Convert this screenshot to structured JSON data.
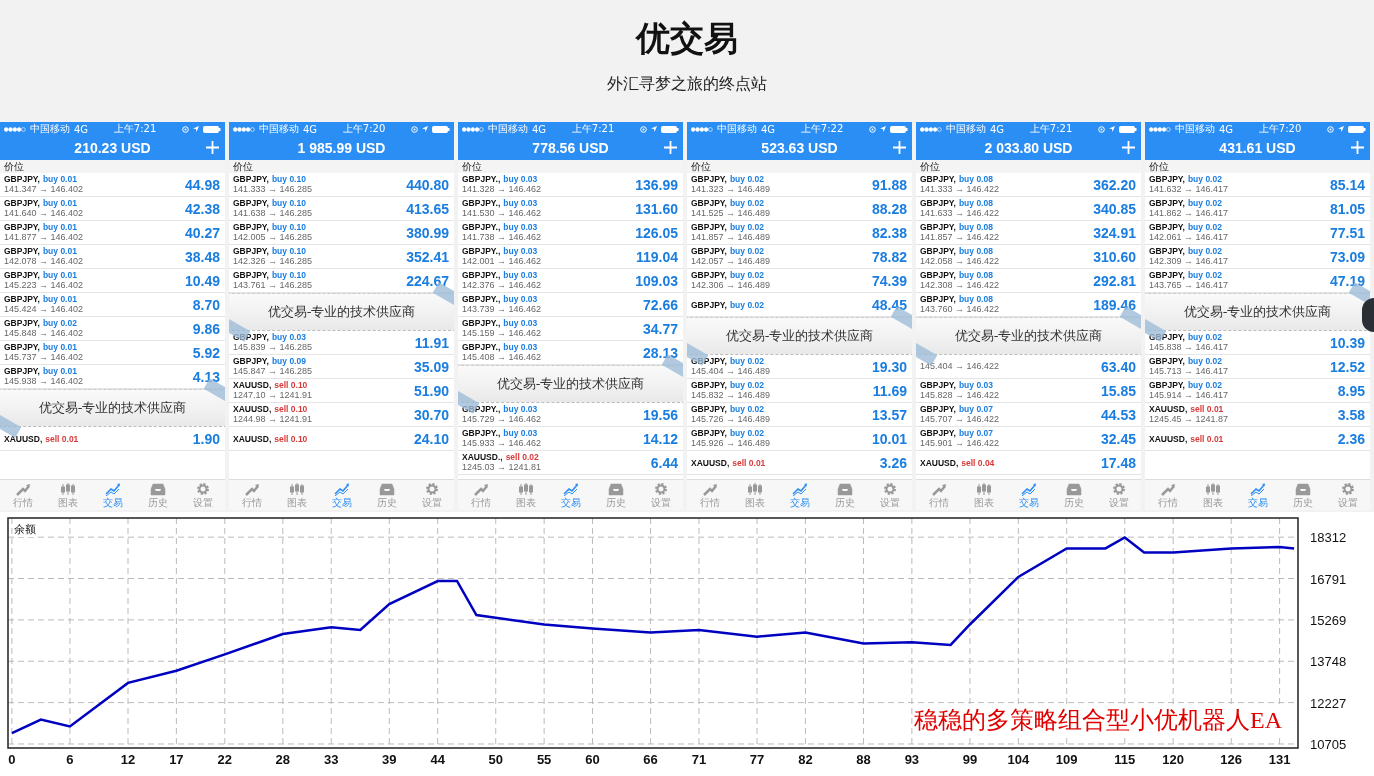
{
  "header": {
    "title": "优交易",
    "subtitle": "外汇寻梦之旅的终点站"
  },
  "phones": [
    {
      "carrier": "中国移动",
      "network": "4G",
      "time": "上午7:21",
      "balance": "210.23 USD",
      "plus": true,
      "column_label": "价位",
      "rows": [
        {
          "kind": "buy",
          "symbol": "GBPJPY,",
          "side": "buy 0.01",
          "price": "141.347 → 146.402",
          "profit": "44.98"
        },
        {
          "kind": "buy",
          "symbol": "GBPJPY,",
          "side": "buy 0.01",
          "price": "141.640 → 146.402",
          "profit": "42.38"
        },
        {
          "kind": "buy",
          "symbol": "GBPJPY,",
          "side": "buy 0.01",
          "price": "141.877 → 146.402",
          "profit": "40.27"
        },
        {
          "kind": "buy",
          "symbol": "GBPJPY,",
          "side": "buy 0.01",
          "price": "142.078 → 146.402",
          "profit": "38.48"
        },
        {
          "kind": "buy",
          "symbol": "GBPJPY,",
          "side": "buy 0.01",
          "price": "145.223 → 146.402",
          "profit": "10.49"
        },
        {
          "kind": "buy",
          "symbol": "GBPJPY,",
          "side": "buy 0.01",
          "price": "145.424 → 146.402",
          "profit": "8.70"
        },
        {
          "kind": "buy",
          "symbol": "GBPJPY,",
          "side": "buy 0.02",
          "price": "145.848 → 146.402",
          "profit": "9.86"
        },
        {
          "kind": "buy",
          "symbol": "GBPJPY,",
          "side": "buy 0.01",
          "price": "145.737 → 146.402",
          "profit": "5.92"
        },
        {
          "kind": "buy",
          "symbol": "GBPJPY,",
          "side": "buy 0.01",
          "price": "145.938 → 146.402",
          "profit": "4.13"
        },
        {
          "kind": "banner",
          "text": "优交易-专业的技术供应商"
        },
        {
          "kind": "sell",
          "symbol": "XAUUSD,",
          "side": "sell 0.01",
          "profit": "1.90"
        }
      ],
      "tabs": [
        {
          "kind": "quotes",
          "label": "行情",
          "selected": false
        },
        {
          "kind": "chart",
          "label": "图表",
          "selected": false
        },
        {
          "kind": "trade",
          "label": "交易",
          "selected": true
        },
        {
          "kind": "history",
          "label": "历史",
          "selected": false
        },
        {
          "kind": "settings",
          "label": "设置",
          "selected": false
        }
      ]
    },
    {
      "carrier": "中国移动",
      "network": "4G",
      "time": "上午7:20",
      "balance": "1 985.99 USD",
      "plus": false,
      "column_label": "价位",
      "rows": [
        {
          "kind": "buy",
          "symbol": "GBPJPY,",
          "side": "buy 0.10",
          "price": "141.333 → 146.285",
          "profit": "440.80"
        },
        {
          "kind": "buy",
          "symbol": "GBPJPY,",
          "side": "buy 0.10",
          "price": "141.638 → 146.285",
          "profit": "413.65"
        },
        {
          "kind": "buy",
          "symbol": "GBPJPY,",
          "side": "buy 0.10",
          "price": "142.005 → 146.285",
          "profit": "380.99"
        },
        {
          "kind": "buy",
          "symbol": "GBPJPY,",
          "side": "buy 0.10",
          "price": "142.326 → 146.285",
          "profit": "352.41"
        },
        {
          "kind": "buy",
          "symbol": "GBPJPY,",
          "side": "buy 0.10",
          "price": "143.761 → 146.285",
          "profit": "224.67"
        },
        {
          "kind": "banner",
          "text": "优交易-专业的技术供应商"
        },
        {
          "kind": "buy",
          "symbol": "GBPJPY,",
          "side": "buy 0.03",
          "price": "145.839 → 146.285",
          "profit": "11.91"
        },
        {
          "kind": "buy",
          "symbol": "GBPJPY,",
          "side": "buy 0.09",
          "price": "145.847 → 146.285",
          "profit": "35.09"
        },
        {
          "kind": "sell",
          "symbol": "XAUUSD,",
          "side": "sell 0.10",
          "price": "1247.10 → 1241.91",
          "profit": "51.90"
        },
        {
          "kind": "sell",
          "symbol": "XAUUSD,",
          "side": "sell 0.10",
          "price": "1244.98 → 1241.91",
          "profit": "30.70"
        },
        {
          "kind": "sell",
          "symbol": "XAUUSD,",
          "side": "sell 0.10",
          "profit": "24.10"
        }
      ],
      "tabs": [
        {
          "kind": "quotes",
          "label": "行情",
          "selected": false
        },
        {
          "kind": "chart",
          "label": "图表",
          "selected": false
        },
        {
          "kind": "trade",
          "label": "交易",
          "selected": true
        },
        {
          "kind": "history",
          "label": "历史",
          "selected": false
        },
        {
          "kind": "settings",
          "label": "设置",
          "selected": false
        }
      ]
    },
    {
      "carrier": "中国移动",
      "network": "4G",
      "time": "上午7:21",
      "balance": "778.56 USD",
      "plus": true,
      "column_label": "价位",
      "rows": [
        {
          "kind": "buy",
          "symbol": "GBPJPY.,",
          "side": "buy 0.03",
          "price": "141.328 → 146.462",
          "profit": "136.99"
        },
        {
          "kind": "buy",
          "symbol": "GBPJPY.,",
          "side": "buy 0.03",
          "price": "141.530 → 146.462",
          "profit": "131.60"
        },
        {
          "kind": "buy",
          "symbol": "GBPJPY.,",
          "side": "buy 0.03",
          "price": "141.738 → 146.462",
          "profit": "126.05"
        },
        {
          "kind": "buy",
          "symbol": "GBPJPY.,",
          "side": "buy 0.03",
          "price": "142.001 → 146.462",
          "profit": "119.04"
        },
        {
          "kind": "buy",
          "symbol": "GBPJPY.,",
          "side": "buy 0.03",
          "price": "142.376 → 146.462",
          "profit": "109.03"
        },
        {
          "kind": "buy",
          "symbol": "GBPJPY.,",
          "side": "buy 0.03",
          "price": "143.739 → 146.462",
          "profit": "72.66"
        },
        {
          "kind": "buy",
          "symbol": "GBPJPY.,",
          "side": "buy 0.03",
          "price": "145.159 → 146.462",
          "profit": "34.77"
        },
        {
          "kind": "buy",
          "symbol": "GBPJPY.,",
          "side": "buy 0.03",
          "price": "145.408 → 146.462",
          "profit": "28.13"
        },
        {
          "kind": "banner",
          "text": "优交易-专业的技术供应商"
        },
        {
          "kind": "buy",
          "symbol": "GBPJPY.,",
          "side": "buy 0.03",
          "price": "145.729 → 146.462",
          "profit": "19.56"
        },
        {
          "kind": "buy",
          "symbol": "GBPJPY.,",
          "side": "buy 0.03",
          "price": "145.933 → 146.462",
          "profit": "14.12"
        },
        {
          "kind": "sell",
          "symbol": "XAUUSD.,",
          "side": "sell 0.02",
          "price": "1245.03 → 1241.81",
          "profit": "6.44"
        }
      ],
      "tabs": [
        {
          "kind": "quotes",
          "label": "行情",
          "selected": false
        },
        {
          "kind": "chart",
          "label": "图表",
          "selected": false
        },
        {
          "kind": "trade",
          "label": "交易",
          "selected": true
        },
        {
          "kind": "history",
          "label": "历史",
          "selected": false
        },
        {
          "kind": "settings",
          "label": "设置",
          "selected": false
        }
      ]
    },
    {
      "carrier": "中国移动",
      "network": "4G",
      "time": "上午7:22",
      "balance": "523.63 USD",
      "plus": true,
      "column_label": "价位",
      "rows": [
        {
          "kind": "buy",
          "symbol": "GBPJPY,",
          "side": "buy 0.02",
          "price": "141.323 → 146.489",
          "profit": "91.88"
        },
        {
          "kind": "buy",
          "symbol": "GBPJPY,",
          "side": "buy 0.02",
          "price": "141.525 → 146.489",
          "profit": "88.28"
        },
        {
          "kind": "buy",
          "symbol": "GBPJPY,",
          "side": "buy 0.02",
          "price": "141.857 → 146.489",
          "profit": "82.38"
        },
        {
          "kind": "buy",
          "symbol": "GBPJPY,",
          "side": "buy 0.02",
          "price": "142.057 → 146.489",
          "profit": "78.82"
        },
        {
          "kind": "buy",
          "symbol": "GBPJPY,",
          "side": "buy 0.02",
          "price": "142.306 → 146.489",
          "profit": "74.39"
        },
        {
          "kind": "buy",
          "symbol": "GBPJPY,",
          "side": "buy 0.02",
          "profit": "48.45"
        },
        {
          "kind": "banner",
          "text": "优交易-专业的技术供应商"
        },
        {
          "kind": "buy",
          "symbol": "GBPJPY,",
          "side": "buy 0.02",
          "price": "145.404 → 146.489",
          "profit": "19.30"
        },
        {
          "kind": "buy",
          "symbol": "GBPJPY,",
          "side": "buy 0.02",
          "price": "145.832 → 146.489",
          "profit": "11.69"
        },
        {
          "kind": "buy",
          "symbol": "GBPJPY,",
          "side": "buy 0.02",
          "price": "145.726 → 146.489",
          "profit": "13.57"
        },
        {
          "kind": "buy",
          "symbol": "GBPJPY,",
          "side": "buy 0.02",
          "price": "145.926 → 146.489",
          "profit": "10.01"
        },
        {
          "kind": "sell",
          "symbol": "XAUUSD,",
          "side": "sell 0.01",
          "profit": "3.26"
        }
      ],
      "tabs": [
        {
          "kind": "quotes",
          "label": "行情",
          "selected": false
        },
        {
          "kind": "chart",
          "label": "图表",
          "selected": false
        },
        {
          "kind": "trade",
          "label": "交易",
          "selected": true
        },
        {
          "kind": "history",
          "label": "历史",
          "selected": false
        },
        {
          "kind": "settings",
          "label": "设置",
          "selected": false
        }
      ]
    },
    {
      "carrier": "中国移动",
      "network": "4G",
      "time": "上午7:21",
      "balance": "2 033.80 USD",
      "plus": true,
      "column_label": "价位",
      "rows": [
        {
          "kind": "buy",
          "symbol": "GBPJPY,",
          "side": "buy 0.08",
          "price": "141.333 → 146.422",
          "profit": "362.20"
        },
        {
          "kind": "buy",
          "symbol": "GBPJPY,",
          "side": "buy 0.08",
          "price": "141.633 → 146.422",
          "profit": "340.85"
        },
        {
          "kind": "buy",
          "symbol": "GBPJPY,",
          "side": "buy 0.08",
          "price": "141.857 → 146.422",
          "profit": "324.91"
        },
        {
          "kind": "buy",
          "symbol": "GBPJPY,",
          "side": "buy 0.08",
          "price": "142.058 → 146.422",
          "profit": "310.60"
        },
        {
          "kind": "buy",
          "symbol": "GBPJPY,",
          "side": "buy 0.08",
          "price": "142.308 → 146.422",
          "profit": "292.81"
        },
        {
          "kind": "buy",
          "symbol": "GBPJPY,",
          "side": "buy 0.08",
          "price": "143.760 → 146.422",
          "profit": "189.46"
        },
        {
          "kind": "banner",
          "text": "优交易-专业的技术供应商"
        },
        {
          "kind": "buy",
          "price": "145.404 → 146.422",
          "profit": "63.40"
        },
        {
          "kind": "buy",
          "symbol": "GBPJPY,",
          "side": "buy 0.03",
          "price": "145.828 → 146.422",
          "profit": "15.85"
        },
        {
          "kind": "buy",
          "symbol": "GBPJPY,",
          "side": "buy 0.07",
          "price": "145.707 → 146.422",
          "profit": "44.53"
        },
        {
          "kind": "buy",
          "symbol": "GBPJPY,",
          "side": "buy 0.07",
          "price": "145.901 → 146.422",
          "profit": "32.45"
        },
        {
          "kind": "sell",
          "symbol": "XAUUSD,",
          "side": "sell 0.04",
          "profit": "17.48"
        }
      ],
      "tabs": [
        {
          "kind": "quotes",
          "label": "行情",
          "selected": false
        },
        {
          "kind": "chart",
          "label": "图表",
          "selected": false
        },
        {
          "kind": "trade",
          "label": "交易",
          "selected": true
        },
        {
          "kind": "history",
          "label": "历史",
          "selected": false
        },
        {
          "kind": "settings",
          "label": "设置",
          "selected": false
        }
      ]
    },
    {
      "carrier": "中国移动",
      "network": "4G",
      "time": "上午7:20",
      "balance": "431.61 USD",
      "plus": true,
      "column_label": "价位",
      "rows": [
        {
          "kind": "buy",
          "symbol": "GBPJPY,",
          "side": "buy 0.02",
          "price": "141.632 → 146.417",
          "profit": "85.14"
        },
        {
          "kind": "buy",
          "symbol": "GBPJPY,",
          "side": "buy 0.02",
          "price": "141.862 → 146.417",
          "profit": "81.05"
        },
        {
          "kind": "buy",
          "symbol": "GBPJPY,",
          "side": "buy 0.02",
          "price": "142.061 → 146.417",
          "profit": "77.51"
        },
        {
          "kind": "buy",
          "symbol": "GBPJPY,",
          "side": "buy 0.02",
          "price": "142.309 → 146.417",
          "profit": "73.09"
        },
        {
          "kind": "buy",
          "symbol": "GBPJPY,",
          "side": "buy 0.02",
          "price": "143.765 → 146.417",
          "profit": "47.19"
        },
        {
          "kind": "banner",
          "text": "优交易-专业的技术供应商"
        },
        {
          "kind": "buy",
          "symbol": "GBPJPY,",
          "side": "buy 0.02",
          "price": "145.838 → 146.417",
          "profit": "10.39"
        },
        {
          "kind": "buy",
          "symbol": "GBPJPY,",
          "side": "buy 0.02",
          "price": "145.713 → 146.417",
          "profit": "12.52"
        },
        {
          "kind": "buy",
          "symbol": "GBPJPY,",
          "side": "buy 0.02",
          "price": "145.914 → 146.417",
          "profit": "8.95"
        },
        {
          "kind": "sell",
          "symbol": "XAUUSD,",
          "side": "sell 0.01",
          "price": "1245.45 → 1241.87",
          "profit": "3.58"
        },
        {
          "kind": "sell",
          "symbol": "XAUUSD,",
          "side": "sell 0.01",
          "profit": "2.36"
        }
      ],
      "tabs": [
        {
          "kind": "quotes",
          "label": "行情",
          "selected": false
        },
        {
          "kind": "chart",
          "label": "图表",
          "selected": false
        },
        {
          "kind": "trade",
          "label": "交易",
          "selected": true
        },
        {
          "kind": "history",
          "label": "历史",
          "selected": false
        },
        {
          "kind": "settings",
          "label": "设置",
          "selected": false
        }
      ]
    }
  ],
  "chart": {
    "annotation": "稳稳的多策略组合型小优机器人EA",
    "chart_data": {
      "type": "line",
      "x": [
        0,
        3,
        6,
        12,
        17,
        22,
        28,
        33,
        36,
        39,
        44,
        46,
        48,
        50,
        55,
        60,
        66,
        71,
        77,
        82,
        88,
        93,
        97,
        99,
        104,
        109,
        113,
        115,
        117,
        120,
        126,
        131,
        132.5
      ],
      "series": [
        {
          "name": "余额",
          "color": "#0000c0",
          "values": [
            11100,
            11600,
            11350,
            12950,
            13400,
            14000,
            14750,
            15000,
            14900,
            15850,
            16700,
            16700,
            15450,
            15350,
            15100,
            14950,
            14800,
            14900,
            14650,
            14800,
            14400,
            14450,
            14350,
            15100,
            16850,
            17900,
            17900,
            18300,
            17750,
            17750,
            17900,
            17950,
            17900
          ]
        }
      ],
      "grid": true,
      "xlim": [
        -0.4,
        132.9
      ],
      "ylim": [
        10557,
        19017
      ],
      "xticks": [
        0,
        6,
        12,
        17,
        22,
        28,
        33,
        39,
        44,
        50,
        55,
        60,
        66,
        71,
        77,
        82,
        88,
        93,
        99,
        104,
        109,
        115,
        120,
        126,
        131
      ],
      "yticks": [
        10705,
        12227,
        13748,
        15269,
        16791,
        18312
      ]
    }
  }
}
